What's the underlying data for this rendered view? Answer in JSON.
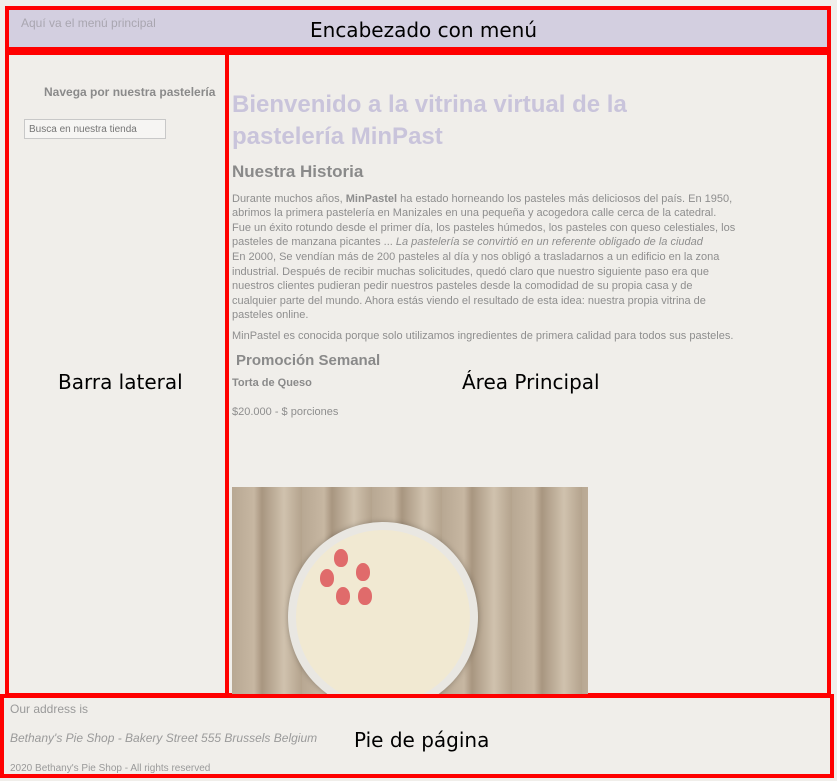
{
  "header": {
    "menu_placeholder": "Aquí va el menú principal",
    "region_label": "Encabezado con menú"
  },
  "sidebar": {
    "title": "Navega por nuestra pastelería",
    "search_placeholder": "Busca en nuestra tienda",
    "region_label": "Barra lateral"
  },
  "main": {
    "region_label": "Área Principal",
    "welcome_title": "Bienvenido a la vitrina virtual de la pastelería MinPast",
    "history_heading": "Nuestra Historia",
    "history_p1_intro": "Durante muchos años, ",
    "history_p1_brand": "MinPastel",
    "history_p1_rest": " ha estado horneando los pasteles más deliciosos del país. En 1950, abrimos la primera pastelería en Manizales en una pequeña y acogedora calle cerca de la catedral. Fue un éxito rotundo desde el primer día, los pasteles húmedos, los pasteles con queso celestiales, los pasteles de manzana picantes ... ",
    "history_p1_italic": "La pastelería se convirtió en un referente obligado de la ciudad",
    "history_p2": "En 2000, Se vendían más de 200 pasteles al día y nos obligó a trasladarnos a un edificio en la zona industrial. Después de recibir muchas solicitudes, quedó claro que nuestro siguiente paso era que nuestros clientes pudieran pedir nuestros pasteles desde la comodidad de su propia casa y de cualquier parte del mundo. Ahora estás viendo el resultado de esta idea: nuestra propia vitrina de pasteles online.",
    "history_p3": "MinPastel es conocida porque solo utilizamos ingredientes de primera calidad para todos sus pasteles.",
    "promo_heading": "Promoción Semanal",
    "promo_item_name": "Torta de Queso",
    "promo_item_price": "$20.000 - $ porciones"
  },
  "footer": {
    "address_label": "Our address is",
    "address": "Bethany's Pie Shop - Bakery Street 555 Brussels Belgium",
    "copyright": "2020 Bethany's Pie Shop - All rights reserved",
    "region_label": "Pie de página"
  },
  "colors": {
    "outline": "#ff0000",
    "header_bg": "#d3cfe0",
    "page_bg": "#f0eeea",
    "welcome_title": "#c9c4db"
  }
}
